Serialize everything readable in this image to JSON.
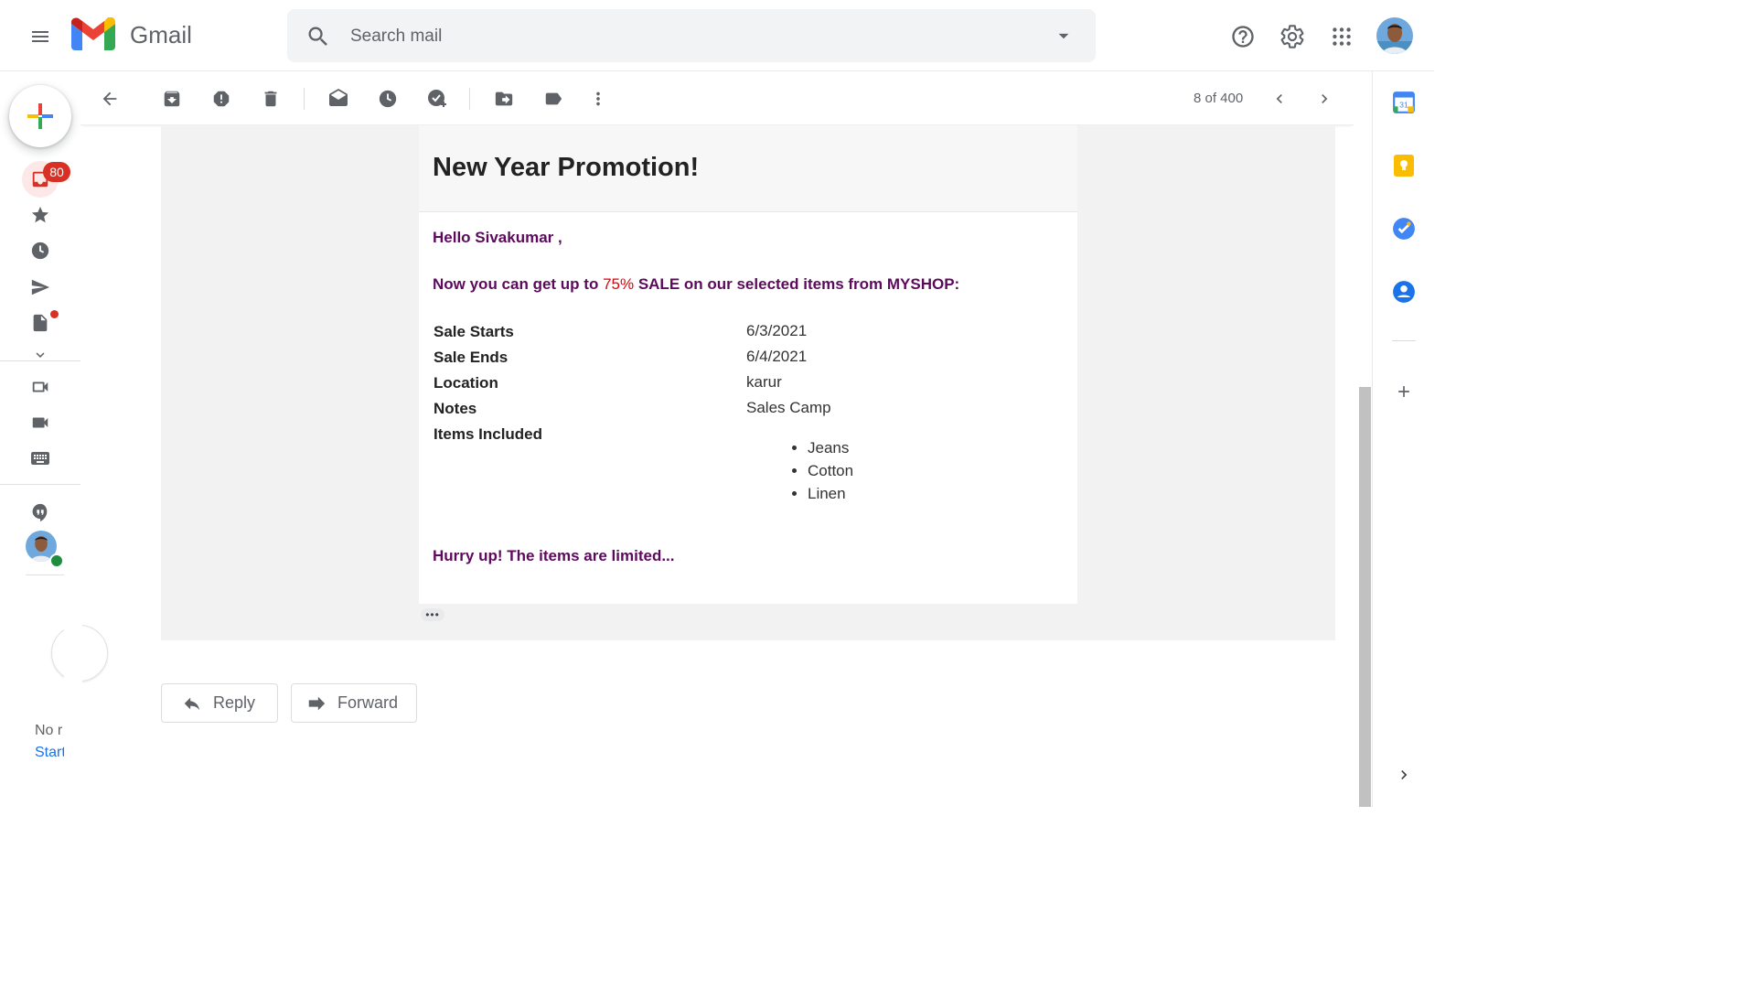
{
  "header": {
    "app_name": "Gmail",
    "search_placeholder": "Search mail",
    "icons": [
      "main-menu-icon",
      "gmail-logo",
      "search-icon",
      "search-options-icon",
      "help-icon",
      "settings-icon",
      "apps-icon",
      "account-avatar"
    ]
  },
  "nav": {
    "inbox_badge": "80",
    "no_recent_text": "No r",
    "start_link_text": "Start",
    "icons": [
      "compose-icon",
      "inbox-icon",
      "starred-icon",
      "snoozed-icon",
      "sent-icon",
      "drafts-icon",
      "more-icon",
      "meet-new-icon",
      "meet-join-icon",
      "keyboard-icon",
      "hangouts-icon"
    ]
  },
  "toolbar": {
    "page_count": "8 of 400",
    "icons": [
      "back-icon",
      "archive-icon",
      "report-spam-icon",
      "delete-icon",
      "mark-unread-icon",
      "snooze-icon",
      "add-task-icon",
      "move-to-icon",
      "label-icon",
      "more-vert-icon",
      "newer-icon",
      "older-icon"
    ]
  },
  "email": {
    "title": "New Year Promotion!",
    "greeting": "Hello Sivakumar ,",
    "promo_prefix": "Now you can get up to ",
    "promo_highlight": "75%",
    "promo_suffix": " SALE on our selected items from MYSHOP:",
    "details": [
      {
        "label": "Sale Starts",
        "value": "6/3/2021"
      },
      {
        "label": "Sale Ends",
        "value": "6/4/2021"
      },
      {
        "label": "Location",
        "value": "karur"
      },
      {
        "label": "Notes",
        "value": "Sales Camp"
      },
      {
        "label": "Items Included",
        "value": ""
      }
    ],
    "items": [
      "Jeans",
      "Cotton",
      "Linen"
    ],
    "closing": "Hurry up! The items are limited...",
    "ellipsis": "•••"
  },
  "actions": {
    "reply_label": "Reply",
    "forward_label": "Forward"
  },
  "side_panel": {
    "calendar_day": "31",
    "icons": [
      "calendar-icon",
      "keep-icon",
      "tasks-icon",
      "contacts-icon",
      "add-addon-icon",
      "expand-panel-icon"
    ]
  },
  "colors": {
    "accent_red": "#d93025",
    "promo_purple": "#5d0a5d",
    "highlight_red": "#e0000a",
    "link_blue": "#1a73e8"
  }
}
